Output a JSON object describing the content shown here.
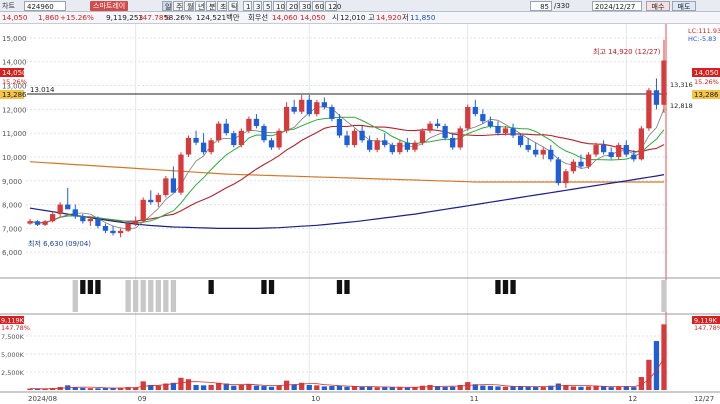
{
  "toolbar": {
    "panel_label": "차트",
    "code": "424960",
    "stock_name": "스마트레이",
    "periods": [
      "일",
      "주",
      "월",
      "년",
      "분",
      "초",
      "틱"
    ],
    "minutes": [
      "1",
      "3",
      "5",
      "10",
      "20",
      "30",
      "60",
      "120"
    ],
    "count": "85",
    "total": "/330",
    "date": "2024/12/27",
    "buy": "매수",
    "sell": "매도"
  },
  "info": {
    "price": "14,050",
    "change": "1,860",
    "change_pct": "+15.26%",
    "volume": "9,119,253",
    "vol_ratio": "147.78%",
    "turnover": "58.26%",
    "amount": "124,521백만",
    "priority": "회우선",
    "best_ask": "14,060",
    "best_bid": "14,050",
    "open_label": "시",
    "open": "12,010",
    "high_label": "고",
    "high": "14,920",
    "low_label": "저",
    "low": "11,850"
  },
  "colors": {
    "up": "#d63a3a",
    "down": "#1d5fd6",
    "ma5": "#7a7a7a",
    "ma10": "#2eaa3e",
    "ma20": "#b3232e",
    "ma60": "#1a1f8a",
    "ma120": "#d07a2a"
  },
  "chart_data": [
    {
      "type": "candlestick",
      "y_ticks": [
        "15,000",
        "14,000",
        "13,000",
        "12,000",
        "11,000",
        "10,000",
        "9,000",
        "8,000",
        "7,000",
        "6,000"
      ],
      "ylim": [
        5000,
        15500
      ],
      "x_ticks": [
        "2024/08",
        "09",
        "10",
        "11",
        "12",
        "12/27"
      ],
      "price_label": "14,050",
      "price_label_pct": "15.26%",
      "ref_label": "13,286",
      "right_tag_1": "LC:111.93",
      "right_tag_2": "HC:-5.83",
      "ref_line": "13.014",
      "high_annotation": "최고 14,920 (12/27)",
      "low_annotation": "최저 6,630 (09/04)",
      "mini_labels": [
        "13,316",
        "12,818"
      ],
      "ohlc": [
        [
          7200,
          7400,
          7150,
          7300
        ],
        [
          7300,
          7350,
          7100,
          7150
        ],
        [
          7150,
          7350,
          7100,
          7300
        ],
        [
          7300,
          7700,
          7250,
          7600
        ],
        [
          7600,
          8100,
          7500,
          8000
        ],
        [
          8000,
          8700,
          7900,
          7800
        ],
        [
          7800,
          8000,
          7400,
          7500
        ],
        [
          7500,
          7600,
          7200,
          7300
        ],
        [
          7300,
          7500,
          7100,
          7400
        ],
        [
          7400,
          7500,
          7000,
          7100
        ],
        [
          7100,
          7200,
          6800,
          6900
        ],
        [
          6900,
          7100,
          6700,
          6800
        ],
        [
          6800,
          7000,
          6630,
          6900
        ],
        [
          6900,
          7300,
          6850,
          7200
        ],
        [
          7200,
          7500,
          7100,
          7300
        ],
        [
          7300,
          8300,
          7250,
          8200
        ],
        [
          8200,
          8600,
          8000,
          8100
        ],
        [
          8100,
          8500,
          7900,
          8400
        ],
        [
          8400,
          9200,
          8300,
          9100
        ],
        [
          9100,
          9600,
          8800,
          8500
        ],
        [
          8500,
          10200,
          8400,
          10100
        ],
        [
          10100,
          10900,
          10000,
          10800
        ],
        [
          10800,
          11100,
          10500,
          10600
        ],
        [
          10600,
          11000,
          10100,
          10200
        ],
        [
          10200,
          10800,
          10100,
          10700
        ],
        [
          10700,
          11500,
          10600,
          11400
        ],
        [
          11400,
          11600,
          10900,
          11000
        ],
        [
          11000,
          11100,
          10400,
          10500
        ],
        [
          10500,
          11200,
          10400,
          11100
        ],
        [
          11100,
          11700,
          11000,
          11600
        ],
        [
          11600,
          11800,
          11200,
          11300
        ],
        [
          11300,
          11400,
          10600,
          10700
        ],
        [
          10700,
          10800,
          10300,
          10400
        ],
        [
          10400,
          11200,
          10300,
          11100
        ],
        [
          11100,
          12300,
          11000,
          12100
        ],
        [
          12100,
          12400,
          11800,
          11900
        ],
        [
          11900,
          12600,
          11800,
          12400
        ],
        [
          12400,
          12600,
          11700,
          11800
        ],
        [
          11800,
          12400,
          11700,
          12300
        ],
        [
          12300,
          12500,
          12000,
          12100
        ],
        [
          12100,
          12200,
          11500,
          11600
        ],
        [
          11600,
          11800,
          10800,
          10900
        ],
        [
          10900,
          11100,
          10400,
          10500
        ],
        [
          10500,
          11200,
          10400,
          11100
        ],
        [
          11100,
          11300,
          10600,
          10700
        ],
        [
          10700,
          10900,
          10200,
          10300
        ],
        [
          10300,
          10800,
          10200,
          10700
        ],
        [
          10700,
          11000,
          10400,
          10500
        ],
        [
          10500,
          10600,
          10100,
          10200
        ],
        [
          10200,
          10700,
          10100,
          10600
        ],
        [
          10600,
          10800,
          10200,
          10300
        ],
        [
          10300,
          10700,
          10200,
          10600
        ],
        [
          10600,
          11200,
          10500,
          11100
        ],
        [
          11100,
          11500,
          11000,
          11400
        ],
        [
          11400,
          11600,
          11200,
          11300
        ],
        [
          11300,
          11400,
          10700,
          10800
        ],
        [
          10800,
          11000,
          10300,
          10400
        ],
        [
          10400,
          11300,
          10300,
          11200
        ],
        [
          11200,
          12200,
          11100,
          12100
        ],
        [
          12100,
          12400,
          11700,
          11800
        ],
        [
          11800,
          12000,
          11400,
          11500
        ],
        [
          11500,
          11700,
          11200,
          11300
        ],
        [
          11300,
          11500,
          10900,
          11000
        ],
        [
          11000,
          11300,
          10900,
          11200
        ],
        [
          11200,
          11400,
          10800,
          10900
        ],
        [
          10900,
          11000,
          10400,
          10500
        ],
        [
          10500,
          10800,
          10200,
          10300
        ],
        [
          10300,
          10600,
          10000,
          10100
        ],
        [
          10100,
          10400,
          9900,
          10300
        ],
        [
          10300,
          10500,
          9800,
          9900
        ],
        [
          9900,
          10000,
          8800,
          8900
        ],
        [
          8900,
          9500,
          8700,
          9400
        ],
        [
          9400,
          9900,
          9300,
          9800
        ],
        [
          9800,
          10100,
          9500,
          9600
        ],
        [
          9600,
          10200,
          9500,
          10100
        ],
        [
          10100,
          10600,
          10000,
          10500
        ],
        [
          10500,
          10700,
          10100,
          10200
        ],
        [
          10200,
          10400,
          9900,
          10000
        ],
        [
          10000,
          10600,
          9900,
          10500
        ],
        [
          10500,
          10700,
          10000,
          10100
        ],
        [
          10100,
          10300,
          9800,
          9900
        ],
        [
          9900,
          11300,
          9850,
          11200
        ],
        [
          11200,
          12900,
          11100,
          12800
        ],
        [
          12800,
          13300,
          12000,
          12190
        ],
        [
          12190,
          14920,
          11850,
          14050
        ]
      ],
      "ma60": [
        7850,
        7800,
        7750,
        7700,
        7650,
        7600,
        7550,
        7500,
        7450,
        7400,
        7350,
        7300,
        7260,
        7220,
        7180,
        7150,
        7120,
        7100,
        7080,
        7060,
        7050,
        7040,
        7030,
        7020,
        7010,
        7000,
        7000,
        7000,
        7000,
        7000,
        7000,
        7010,
        7020,
        7030,
        7050,
        7070,
        7090,
        7110,
        7130,
        7160,
        7190,
        7220,
        7250,
        7280,
        7320,
        7360,
        7400,
        7440,
        7480,
        7520,
        7560,
        7600,
        7650,
        7700,
        7750,
        7800,
        7850,
        7900,
        7950,
        8000,
        8050,
        8100,
        8150,
        8200,
        8250,
        8300,
        8350,
        8400,
        8450,
        8500,
        8550,
        8600,
        8650,
        8700,
        8750,
        8800,
        8850,
        8900,
        8950,
        9000,
        9050,
        9100,
        9150,
        9200,
        9260
      ],
      "ma120": [
        9800,
        9780,
        9760,
        9740,
        9720,
        9700,
        9680,
        9660,
        9640,
        9620,
        9600,
        9580,
        9560,
        9540,
        9520,
        9500,
        9480,
        9460,
        9440,
        9420,
        9400,
        9380,
        9360,
        9340,
        9320,
        9300,
        9280,
        9270,
        9260,
        9250,
        9240,
        9230,
        9220,
        9210,
        9200,
        9190,
        9180,
        9170,
        9160,
        9150,
        9140,
        9130,
        9120,
        9110,
        9100,
        9090,
        9080,
        9070,
        9060,
        9050,
        9040,
        9030,
        9020,
        9010,
        9000,
        8990,
        8980,
        8970,
        8960,
        8950,
        8950,
        8950,
        8950,
        8950,
        8950,
        8950,
        8950,
        8950,
        8950,
        8950,
        8950,
        8950,
        8950,
        8950,
        8950,
        8950,
        8950,
        8950,
        8950,
        8950,
        8950,
        8950,
        8950,
        8950,
        8950
      ]
    },
    {
      "type": "bar",
      "signal_values": [
        0,
        0,
        0,
        0,
        0,
        0,
        1,
        -1,
        -1,
        -1,
        0,
        0,
        0,
        1,
        1,
        1,
        1,
        1,
        1,
        1,
        0,
        0,
        0,
        0,
        -1,
        0,
        0,
        0,
        0,
        0,
        0,
        -1,
        -1,
        0,
        0,
        0,
        0,
        0,
        0,
        0,
        0,
        -1,
        -1,
        0,
        0,
        0,
        0,
        0,
        0,
        0,
        0,
        0,
        0,
        0,
        0,
        0,
        0,
        0,
        0,
        0,
        0,
        0,
        -1,
        -1,
        -1,
        0,
        0,
        0,
        0,
        0,
        0,
        0,
        0,
        0,
        0,
        0,
        0,
        0,
        0,
        0,
        0,
        0,
        0,
        0,
        1
      ]
    },
    {
      "type": "bar",
      "y_ticks": [
        "7,500K",
        "5,000K",
        "2,500K"
      ],
      "tag_value": "9,119K",
      "tag_pct": "147.78%",
      "ylim": [
        0,
        10000
      ],
      "values": [
        200,
        150,
        160,
        260,
        420,
        650,
        380,
        300,
        260,
        240,
        330,
        280,
        300,
        400,
        380,
        1200,
        700,
        600,
        900,
        1000,
        1700,
        1500,
        700,
        650,
        700,
        1000,
        900,
        600,
        700,
        800,
        600,
        550,
        450,
        650,
        1300,
        800,
        1000,
        700,
        650,
        500,
        550,
        600,
        450,
        500,
        420,
        450,
        380,
        400,
        350,
        400,
        320,
        380,
        600,
        700,
        500,
        420,
        450,
        700,
        1100,
        800,
        600,
        550,
        500,
        450,
        500,
        500,
        480,
        420,
        450,
        600,
        900,
        700,
        500,
        450,
        500,
        600,
        520,
        400,
        450,
        500,
        400,
        1800,
        4200,
        6800,
        9119
      ]
    }
  ]
}
